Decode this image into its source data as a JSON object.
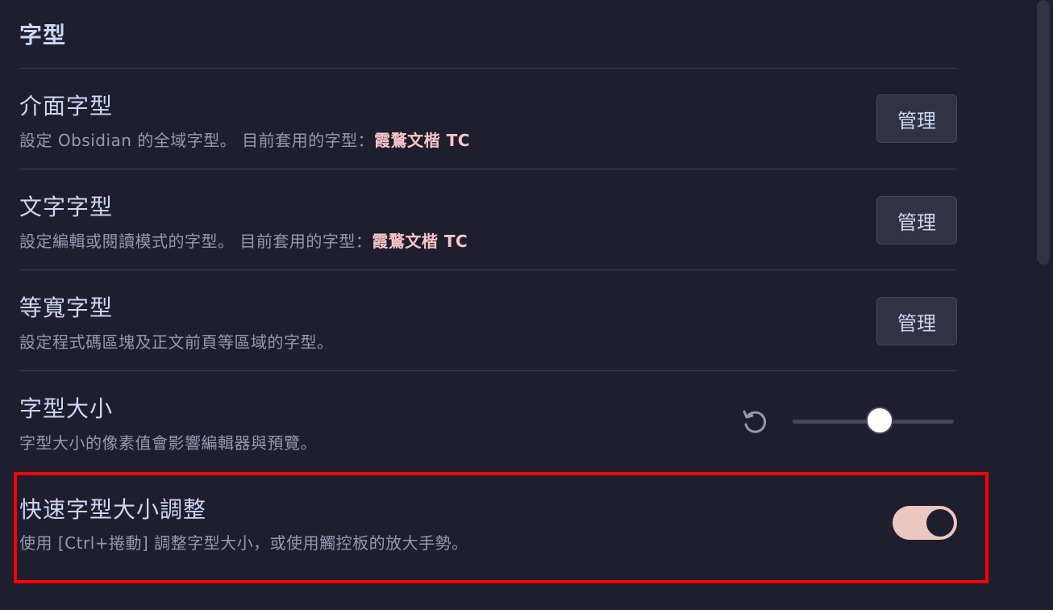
{
  "section": {
    "title": "字型"
  },
  "settings": {
    "interface_font": {
      "name": "介面字型",
      "desc_prefix": "設定 Obsidian 的全域字型。 目前套用的字型：",
      "current_font": "霞鶩文楷 TC",
      "button_label": "管理"
    },
    "text_font": {
      "name": "文字字型",
      "desc_prefix": "設定編輯或閱讀模式的字型。 目前套用的字型：",
      "current_font": "霞鶩文楷 TC",
      "button_label": "管理"
    },
    "monospace_font": {
      "name": "等寬字型",
      "desc": "設定程式碼區塊及正文前頁等區域的字型。",
      "button_label": "管理"
    },
    "font_size": {
      "name": "字型大小",
      "desc": "字型大小的像素值會影響編輯器與預覽。",
      "reset_icon": "reset-icon",
      "slider_fraction": 0.54
    },
    "quick_font_size": {
      "name": "快速字型大小調整",
      "desc": "使用 [Ctrl+捲動] 調整字型大小，或使用觸控板的放大手勢。",
      "enabled": true
    }
  },
  "colors": {
    "background": "#1f1e2e",
    "accent": "#ecc7c2",
    "highlight": "#ff0000"
  }
}
